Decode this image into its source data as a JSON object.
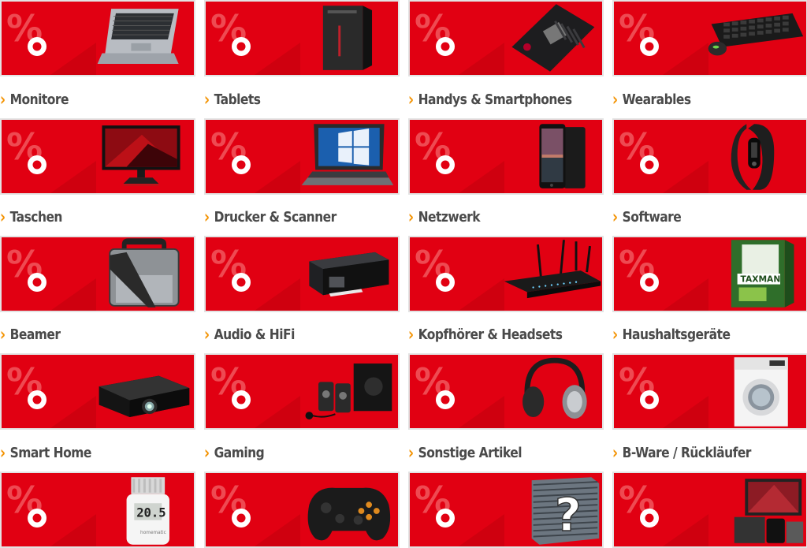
{
  "colors": {
    "brand_red": "#e10012",
    "chevron": "#f39200",
    "label_text": "#4a4a4a",
    "tile_frame": "#e3e3e3"
  },
  "chevron_glyph": "›",
  "labels": [
    "Monitore",
    "Tablets",
    "Handys & Smartphones",
    "Wearables",
    "Taschen",
    "Drucker & Scanner",
    "Netzwerk",
    "Software",
    "Beamer",
    "Audio & HiFi",
    "Kopfhörer & Headsets",
    "Haushaltsgeräte",
    "Smart Home",
    "Gaming",
    "Sonstige Artikel",
    "B-Ware / Rückläufer"
  ],
  "tiles": [
    {
      "icon": "laptop-icon"
    },
    {
      "icon": "pc-tower-icon"
    },
    {
      "icon": "motherboard-icon"
    },
    {
      "icon": "keyboard-mouse-icon"
    },
    {
      "icon": "monitor-icon"
    },
    {
      "icon": "tablet-keyboard-icon"
    },
    {
      "icon": "smartphone-icon"
    },
    {
      "icon": "fitness-band-icon"
    },
    {
      "icon": "bag-icon"
    },
    {
      "icon": "printer-icon"
    },
    {
      "icon": "router-icon"
    },
    {
      "icon": "software-box-icon"
    },
    {
      "icon": "projector-icon"
    },
    {
      "icon": "speakers-icon"
    },
    {
      "icon": "headphones-icon"
    },
    {
      "icon": "washing-machine-icon"
    },
    {
      "icon": "thermostat-icon",
      "display": "20.5"
    },
    {
      "icon": "gamepad-icon"
    },
    {
      "icon": "mystery-box-icon",
      "display": "?"
    },
    {
      "icon": "bware-products-icon"
    }
  ]
}
